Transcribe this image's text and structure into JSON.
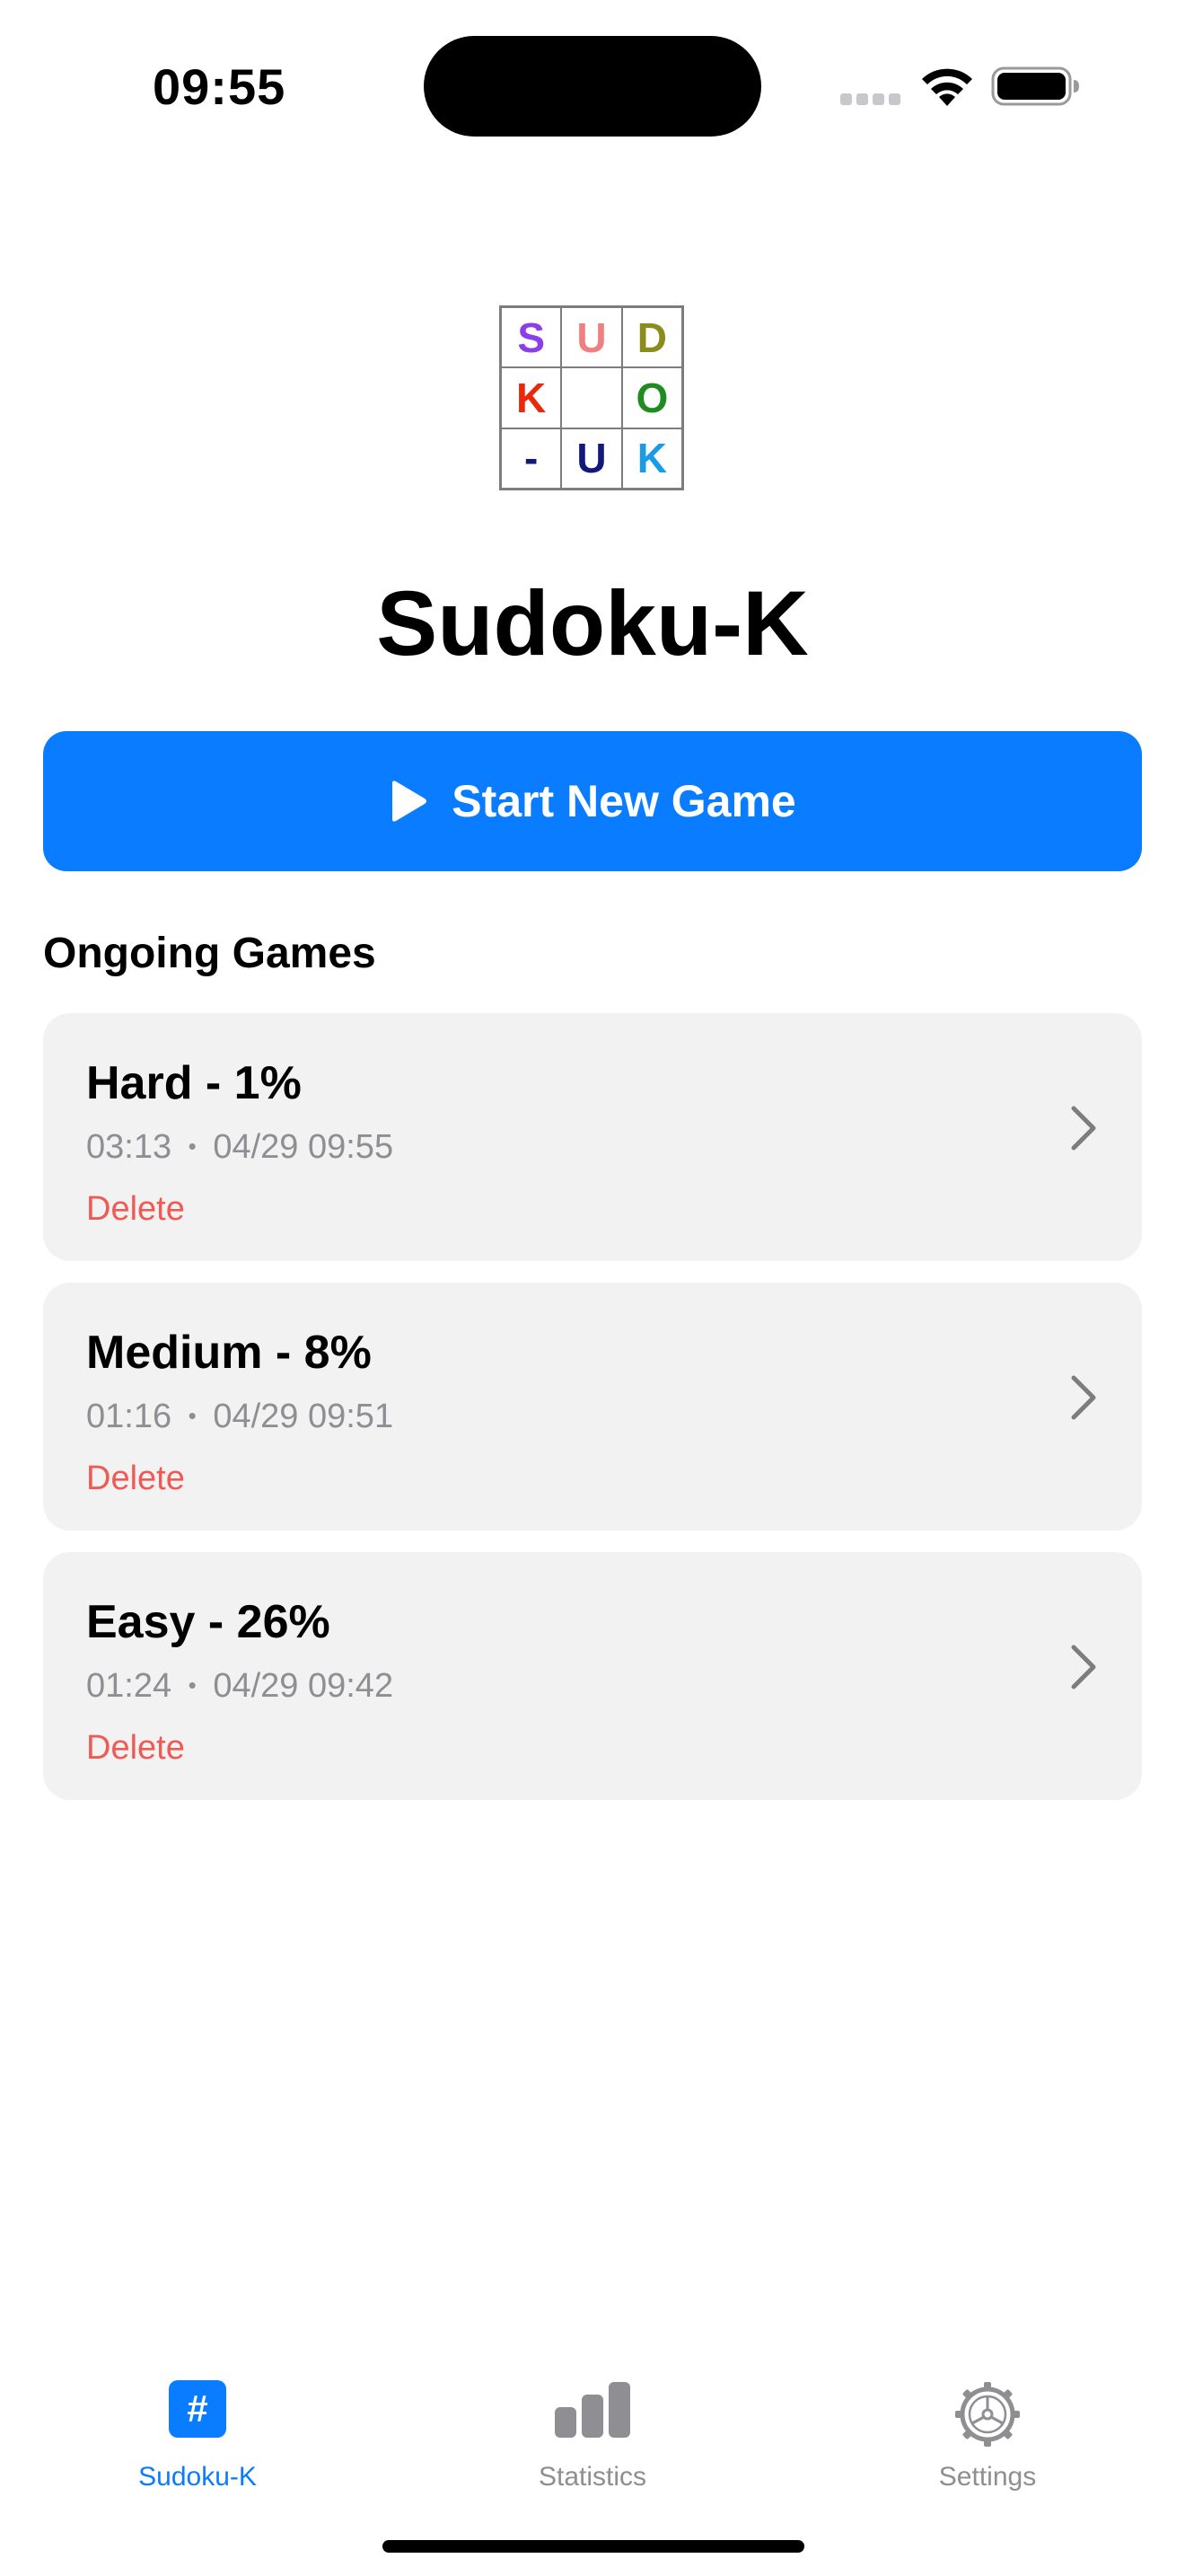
{
  "status_bar": {
    "time": "09:55"
  },
  "logo": {
    "cells": [
      {
        "letter": "S",
        "color": "#8b3fe6"
      },
      {
        "letter": "U",
        "color": "#f08080"
      },
      {
        "letter": "D",
        "color": "#8c8c1a"
      },
      {
        "letter": "K",
        "color": "#e8290b"
      },
      {
        "letter": "",
        "color": "#000000"
      },
      {
        "letter": "O",
        "color": "#1e8c1e"
      },
      {
        "letter": "-",
        "color": "#13197a"
      },
      {
        "letter": "U",
        "color": "#13197a"
      },
      {
        "letter": "K",
        "color": "#1a9be6"
      }
    ]
  },
  "app_title": "Sudoku-K",
  "start_button": {
    "label": "Start New Game",
    "icon": "play-icon",
    "color": "#0a7cff"
  },
  "ongoing": {
    "heading": "Ongoing Games",
    "games": [
      {
        "title": "Hard - 1%",
        "duration": "03:13",
        "separator": "•",
        "datetime": "04/29 09:55",
        "delete_label": "Delete"
      },
      {
        "title": "Medium - 8%",
        "duration": "01:16",
        "separator": "•",
        "datetime": "04/29 09:51",
        "delete_label": "Delete"
      },
      {
        "title": "Easy - 26%",
        "duration": "01:24",
        "separator": "•",
        "datetime": "04/29 09:42",
        "delete_label": "Delete"
      }
    ]
  },
  "tab_bar": {
    "items": [
      {
        "label": "Sudoku-K",
        "icon": "hash-icon",
        "active": true,
        "glyph": "#"
      },
      {
        "label": "Statistics",
        "icon": "bar-chart-icon",
        "active": false
      },
      {
        "label": "Settings",
        "icon": "gear-icon",
        "active": false
      }
    ],
    "active_color": "#0a7cff",
    "inactive_color": "#8e8e93"
  }
}
